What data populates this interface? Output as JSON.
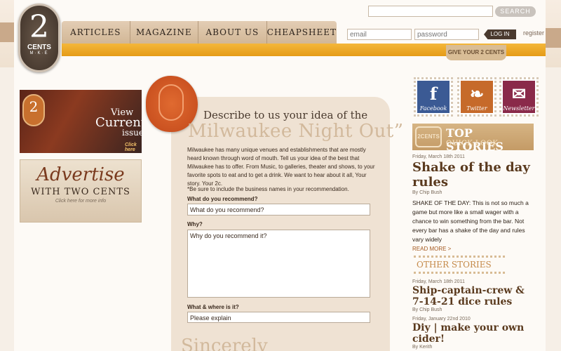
{
  "header": {
    "logo": {
      "big": "2",
      "small": "CENTS",
      "sub": "M·K·E"
    },
    "nav": [
      "ARTICLES",
      "MAGAZINE",
      "ABOUT US",
      "CHEAPSHEET"
    ],
    "search_button": "SEARCH",
    "email_placeholder": "email",
    "password_placeholder": "password",
    "login_label": "LOG IN",
    "register_label": "register",
    "give_tab": "GIVE YOUR 2 CENTS"
  },
  "left": {
    "promo_current": {
      "badge": "2",
      "line1": "View",
      "line2": "Current",
      "line3": "issue",
      "cta": "Click here"
    },
    "promo_advertise": {
      "line1": "Advertise",
      "line2": "WITH TWO CENTS",
      "line3": "Click here for more info"
    }
  },
  "form": {
    "title_small": "Describe to us your idea of the",
    "title_big": "Milwaukee Night Out”",
    "intro": "Milwaukee has many unique venues and establishments that are mostly heard known through word of mouth. Tell us your idea of the best that Milwaukee has to offer. From Music, to galleries, theater and shows, to your favorite spots to eat and to get a drink. We want to hear about it all, Your story. Your 2c.",
    "note": "*Be sure to include the business names in your recommendation.",
    "q1_label": "What do you recommend?",
    "q1_value": "What do you recommend?",
    "q2_label": "Why?",
    "q2_value": "Why do you recommend it?",
    "q3_label": "What & where is it?",
    "q3_value": "Please explain",
    "closing": "Sincerely"
  },
  "right": {
    "stamps": [
      {
        "label": "Facebook",
        "glyph": "f",
        "color": "#3b5a94"
      },
      {
        "label": "Twitter",
        "glyph": "❧",
        "color": "#c66a2a"
      },
      {
        "label": "Newsletter",
        "glyph": "✉",
        "color": "#8a2a4a"
      }
    ],
    "top_stories": {
      "badge": "2CENTS",
      "title": "TOP STORIES",
      "subtitle": "QUICK LOOK"
    },
    "story1": {
      "date": "Friday, March 18th 2011",
      "title": "Shake of the day rules",
      "by": "By Chip Bush",
      "body": "SHAKE OF THE DAY: This is not so much a game but more like a small wager with a chance to win something from the bar. Not every bar has a shake of the day and rules vary widely",
      "read_more": "READ MORE >"
    },
    "other_heading": "OTHER STORIES",
    "story2": {
      "date": "Friday, March 18th 2011",
      "title": "Ship-captain-crew & 7-14-21 dice rules",
      "by": "By Chip Bush"
    },
    "story3": {
      "date": "Friday, January 22nd 2010",
      "title": "Diy | make your own cider!",
      "by": "By Kerith"
    }
  }
}
